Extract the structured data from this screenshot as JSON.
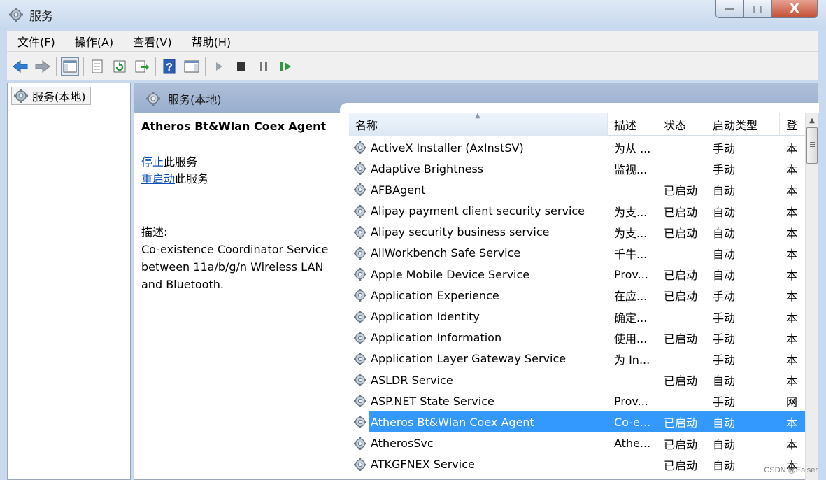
{
  "window": {
    "title": "服务"
  },
  "window_buttons": {
    "minimize": "—",
    "maximize": "□",
    "close": "X"
  },
  "menu": [
    "文件(F)",
    "操作(A)",
    "查看(V)",
    "帮助(H)"
  ],
  "toolbar_icons": [
    "back-icon",
    "forward-icon",
    "show-hide-console-tree-icon",
    "properties-icon",
    "refresh-icon",
    "export-list-icon",
    "help-icon",
    "action-pane-icon",
    "start-service-icon",
    "stop-service-icon",
    "pause-service-icon",
    "resume-service-icon"
  ],
  "tree": {
    "root_label": "服务(本地)"
  },
  "panel": {
    "header_label": "服务(本地)"
  },
  "detail": {
    "service_title": "Atheros Bt&Wlan Coex Agent",
    "stop_link": "停止",
    "stop_suffix": "此服务",
    "restart_link": "重启动",
    "restart_suffix": "此服务",
    "description_label": "描述:",
    "description_lines": [
      "Co-existence Coordinator Service",
      "between 11a/b/g/n Wireless LAN",
      "and Bluetooth."
    ]
  },
  "columns": [
    "名称",
    "描述",
    "状态",
    "启动类型",
    "登"
  ],
  "services": [
    {
      "name": "ActiveX Installer (AxInstSV)",
      "desc": "为从 ...",
      "status": "",
      "startup": "手动",
      "logon": "本"
    },
    {
      "name": "Adaptive Brightness",
      "desc": "监视...",
      "status": "",
      "startup": "手动",
      "logon": "本"
    },
    {
      "name": "AFBAgent",
      "desc": "",
      "status": "已启动",
      "startup": "自动",
      "logon": "本"
    },
    {
      "name": "Alipay payment client security service",
      "desc": "为支...",
      "status": "已启动",
      "startup": "自动",
      "logon": "本"
    },
    {
      "name": "Alipay security business service",
      "desc": "为支...",
      "status": "已启动",
      "startup": "自动",
      "logon": "本"
    },
    {
      "name": "AliWorkbench Safe Service",
      "desc": "千牛...",
      "status": "",
      "startup": "自动",
      "logon": "本"
    },
    {
      "name": "Apple Mobile Device Service",
      "desc": "Prov...",
      "status": "已启动",
      "startup": "自动",
      "logon": "本"
    },
    {
      "name": "Application Experience",
      "desc": "在应...",
      "status": "已启动",
      "startup": "手动",
      "logon": "本"
    },
    {
      "name": "Application Identity",
      "desc": "确定...",
      "status": "",
      "startup": "手动",
      "logon": "本"
    },
    {
      "name": "Application Information",
      "desc": "使用...",
      "status": "已启动",
      "startup": "手动",
      "logon": "本"
    },
    {
      "name": "Application Layer Gateway Service",
      "desc": "为 In...",
      "status": "",
      "startup": "手动",
      "logon": "本"
    },
    {
      "name": "ASLDR Service",
      "desc": "",
      "status": "已启动",
      "startup": "自动",
      "logon": "本"
    },
    {
      "name": "ASP.NET State Service",
      "desc": "Prov...",
      "status": "",
      "startup": "手动",
      "logon": "网"
    },
    {
      "name": "Atheros Bt&Wlan Coex Agent",
      "desc": "Co-e...",
      "status": "已启动",
      "startup": "自动",
      "logon": "本",
      "selected": true
    },
    {
      "name": "AtherosSvc",
      "desc": "Athe...",
      "status": "已启动",
      "startup": "自动",
      "logon": "本"
    },
    {
      "name": "ATKGFNEX Service",
      "desc": "",
      "status": "已启动",
      "startup": "自动",
      "logon": "本"
    }
  ],
  "watermark": "CSDN @Ealser"
}
